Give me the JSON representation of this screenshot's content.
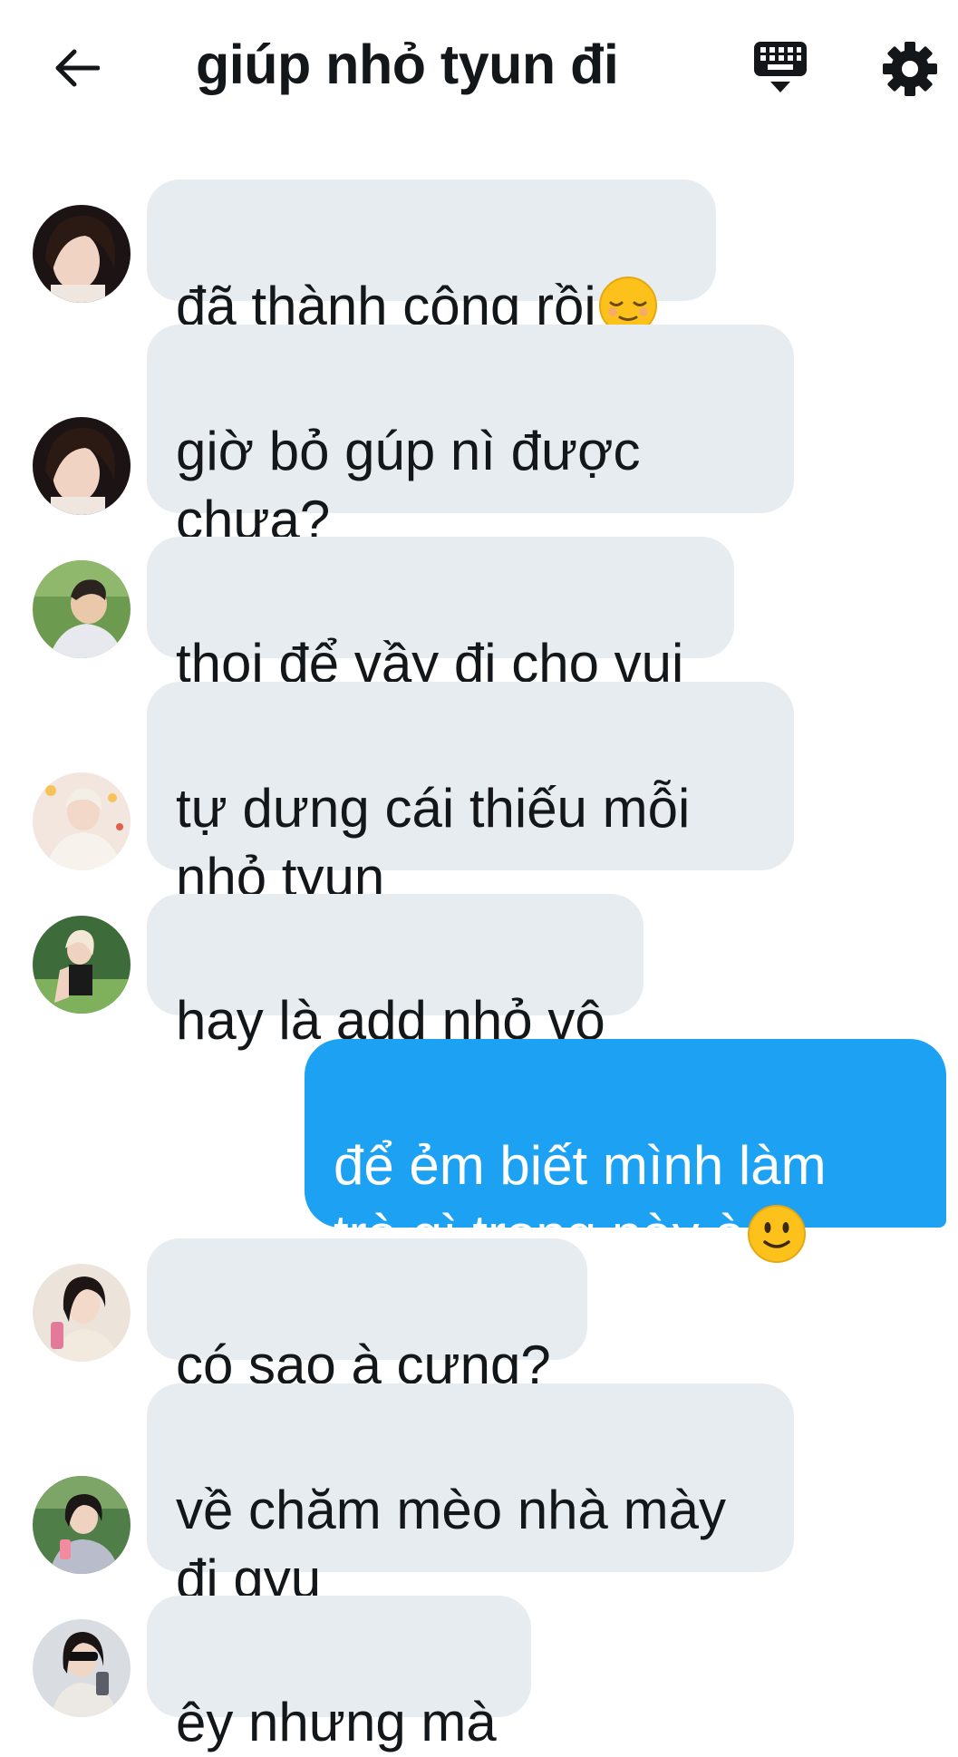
{
  "header": {
    "title": "giúp nhỏ tyun đi",
    "back_icon": "arrow-left-icon",
    "keyboard_icon": "keyboard-icon",
    "settings_icon": "gear-icon"
  },
  "colors": {
    "incoming_bubble": "#e6ecf0",
    "outgoing_bubble": "#1da1f2",
    "text": "#14171a"
  },
  "messages": [
    {
      "direction": "in",
      "text": "đã thành công rồi",
      "emoji": "relieved-face-emoji"
    },
    {
      "direction": "in",
      "text": "giờ bỏ gúp nì được\nchưa?"
    },
    {
      "direction": "in",
      "text": "thoi để vầy đi cho vui"
    },
    {
      "direction": "in",
      "text": "tự dưng cái thiếu mỗi\nnhỏ tyun"
    },
    {
      "direction": "in",
      "text": "hay là add nhỏ vô"
    },
    {
      "direction": "out",
      "text": "để ẻm biết mình làm\ntrò gì trong này à",
      "emoji": "slightly-smiling-face-emoji"
    },
    {
      "direction": "in",
      "text": "có sao à cưng?"
    },
    {
      "direction": "in",
      "text": "về chăm mèo nhà mày\nđi gyu"
    },
    {
      "direction": "in",
      "text": "êy nhưng mà"
    }
  ]
}
